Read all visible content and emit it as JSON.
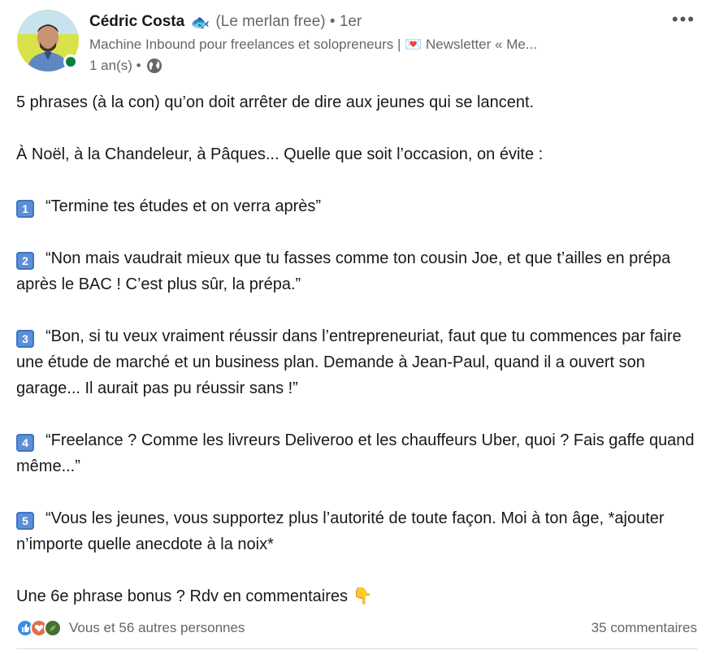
{
  "author": {
    "name": "Cédric Costa",
    "name_emoji": "🐟",
    "nickname": "(Le merlan free)",
    "separator": "•",
    "connection": "1er",
    "headline": "Machine Inbound pour freelances et solopreneurs | 💌 Newsletter « Me...",
    "time": "1 an(s) •",
    "visibility_icon": "globe-icon"
  },
  "post": {
    "title": "5 phrases (à la con) qu’on doit arrêter de dire aux jeunes qui se lancent.",
    "intro": "À Noël, à la Chandeleur, à Pâques... Quelle que soit l’occasion, on évite :",
    "items": [
      {
        "number": "1",
        "text": "“Termine tes études et on verra après”"
      },
      {
        "number": "2",
        "text": "“Non mais vaudrait mieux que tu fasses comme ton cousin Joe, et que t’ailles en prépa après le BAC ! C’est plus sûr, la prépa.”"
      },
      {
        "number": "3",
        "text": "“Bon, si tu veux vraiment réussir dans l’entrepreneuriat, faut que tu commences par faire une étude de marché et un business plan. Demande à Jean-Paul, quand il a ouvert son garage... Il aurait pas pu réussir sans !”"
      },
      {
        "number": "4",
        "text": "“Freelance ? Comme les livreurs Deliveroo et les chauffeurs Uber, quoi ? Fais gaffe quand même...”"
      },
      {
        "number": "5",
        "text": "“Vous les jeunes, vous supportez plus l’autorité de toute façon. Moi à ton âge, *ajouter n’importe quelle anecdote à la noix*"
      }
    ],
    "closing": "Une 6e phrase bonus ? Rdv en commentaires",
    "closing_emoji": "👇"
  },
  "social": {
    "reactions_text": "Vous et 56 autres personnes",
    "reaction_icons": [
      "like-icon",
      "love-icon",
      "support-icon"
    ],
    "comments_text": "35 commentaires"
  },
  "colors": {
    "presence": "#0a7d3f",
    "keycap": "#5b8fd8",
    "like": "#378fe9",
    "love": "#df704d",
    "support": "#44712e"
  }
}
